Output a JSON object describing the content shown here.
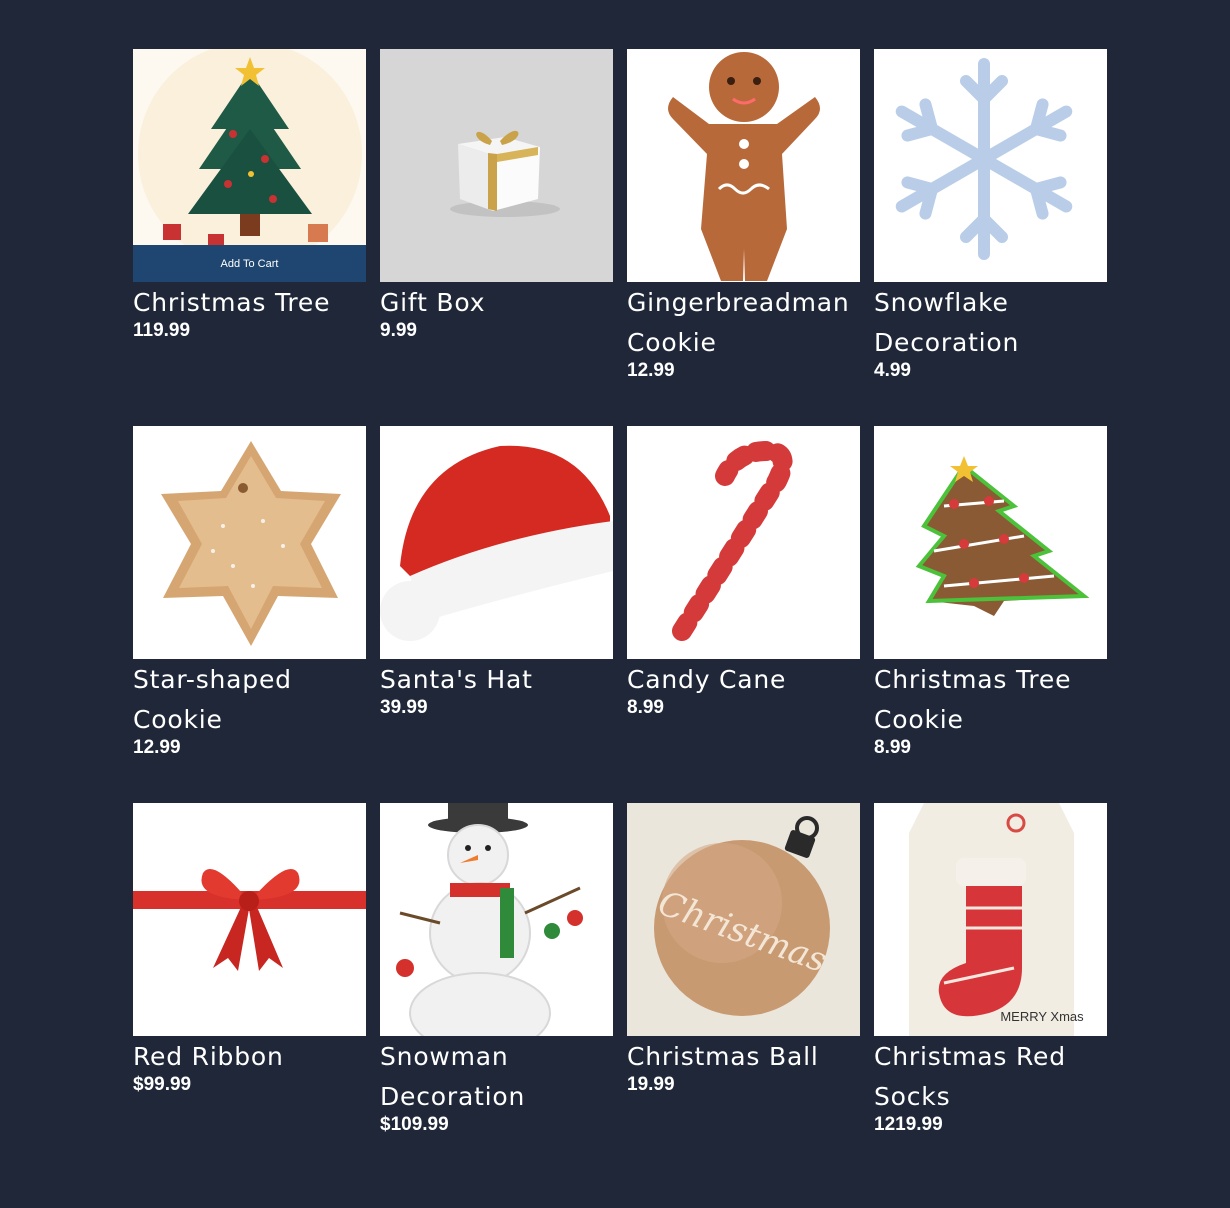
{
  "products": [
    {
      "name": "Christmas Tree",
      "price": "119.99",
      "icon": "christmas-tree-icon",
      "cta": "Add To Cart"
    },
    {
      "name": "Gift Box",
      "price": "9.99",
      "icon": "gift-box-icon"
    },
    {
      "name": "Gingerbreadman Cookie",
      "price": "12.99",
      "icon": "gingerbread-man-icon"
    },
    {
      "name": "Snowflake Decoration",
      "price": "4.99",
      "icon": "snowflake-icon"
    },
    {
      "name": "Star-shaped Cookie",
      "price": "12.99",
      "icon": "star-cookie-icon"
    },
    {
      "name": "Santa's Hat",
      "price": "39.99",
      "icon": "santa-hat-icon"
    },
    {
      "name": "Candy Cane",
      "price": "8.99",
      "icon": "candy-cane-icon"
    },
    {
      "name": "Christmas Tree Cookie",
      "price": "8.99",
      "icon": "tree-cookie-icon"
    },
    {
      "name": "Red Ribbon",
      "price": "$99.99",
      "icon": "red-ribbon-icon"
    },
    {
      "name": "Snowman Decoration",
      "price": "$109.99",
      "icon": "snowman-icon"
    },
    {
      "name": "Christmas Ball",
      "price": "19.99",
      "icon": "christmas-ball-icon",
      "ball_text": "Christmas"
    },
    {
      "name": "Christmas Red Socks",
      "price": "1219.99",
      "icon": "christmas-stocking-icon",
      "tag_text": "MERRY Xmas"
    }
  ]
}
